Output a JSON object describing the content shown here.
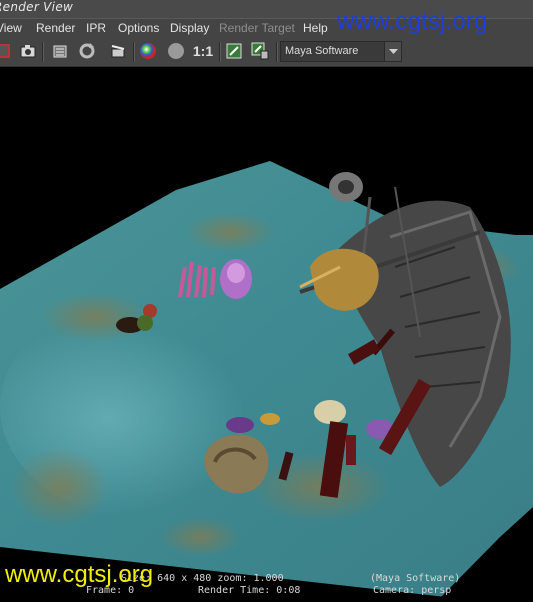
{
  "window": {
    "title": "Render View"
  },
  "watermark": {
    "top_text": "www.cgtsj.org",
    "bottom_text": "www.cgtsj.org"
  },
  "menu": {
    "items": [
      {
        "label": "View"
      },
      {
        "label": "Render"
      },
      {
        "label": "IPR"
      },
      {
        "label": "Options"
      },
      {
        "label": "Display"
      },
      {
        "label": "Render Target",
        "disabled": true
      },
      {
        "label": "Help"
      }
    ]
  },
  "toolbar": {
    "icons": [
      "render-region-icon",
      "snapshot-icon",
      "ipr-render-icon",
      "refresh-icon",
      "render-sequence-icon",
      "color-channel-icon",
      "alpha-channel-icon",
      "real-size-icon",
      "keep-image-icon",
      "remove-image-icon"
    ],
    "real_size_label": "1:1",
    "renderer": {
      "value": "Maya Software"
    }
  },
  "status": {
    "size_label": "Size:",
    "size_value": "640 x 480",
    "zoom_label": "zoom:",
    "zoom_value": "1.000",
    "renderer": "(Maya Software)",
    "frame_label": "Frame:",
    "frame_value": "0",
    "render_time_label": "Render Time:",
    "render_time_value": "0:08",
    "camera_label": "Camera:",
    "camera_value": "persp"
  },
  "colors": {
    "title_bg": "#4a4a4a",
    "toolbar_bg": "#444444",
    "watermark_blue": "#1f3fd6",
    "watermark_yellow": "#f2ee00",
    "water": "#3f8b92"
  }
}
